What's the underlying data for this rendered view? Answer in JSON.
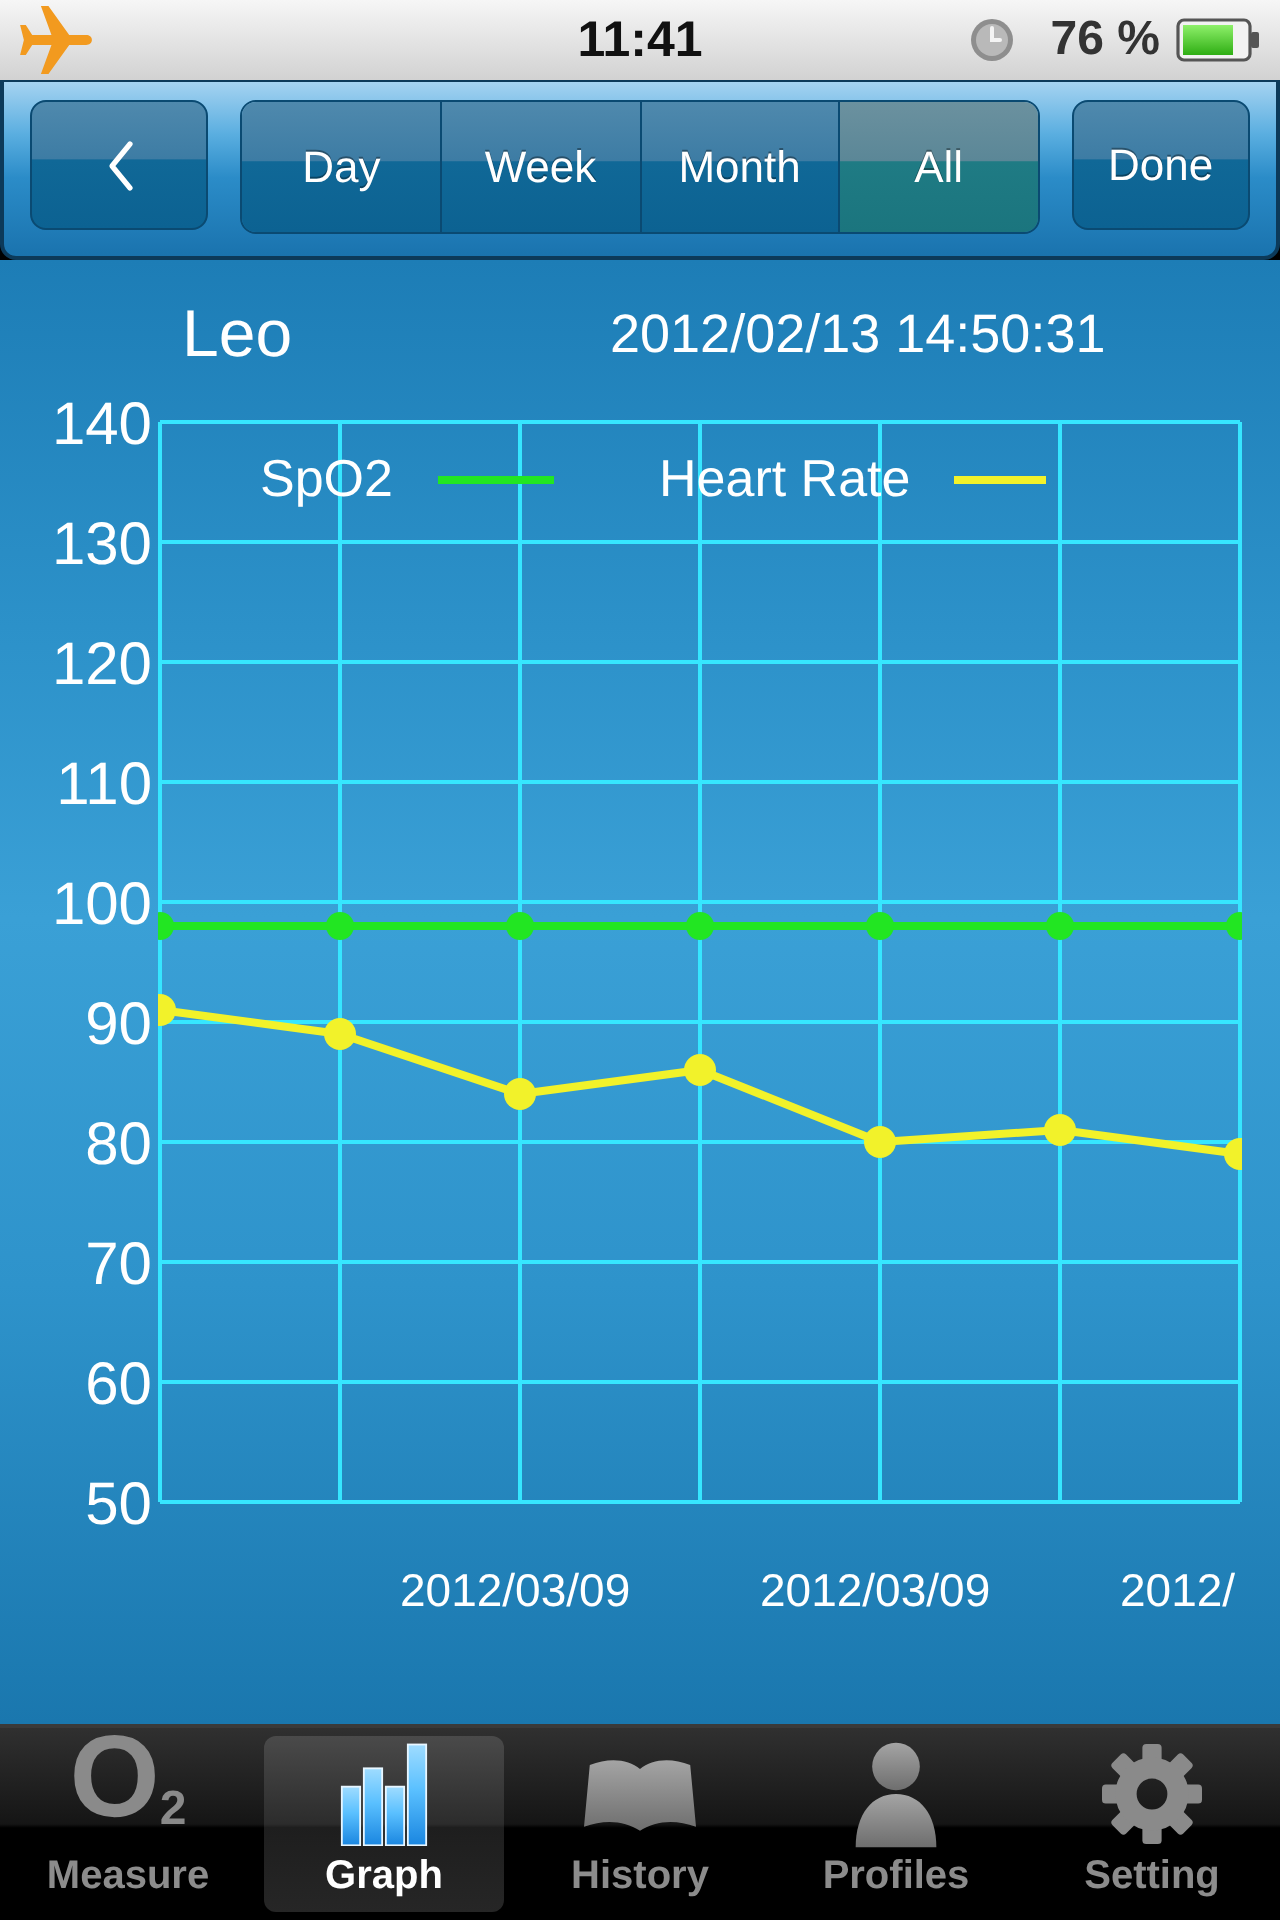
{
  "status_bar": {
    "time": "11:41",
    "battery_percent": "76 %"
  },
  "nav_bar": {
    "segments": [
      {
        "label": "Day",
        "selected": false
      },
      {
        "label": "Week",
        "selected": false
      },
      {
        "label": "Month",
        "selected": false
      },
      {
        "label": "All",
        "selected": true
      }
    ],
    "done_button": "Done"
  },
  "graph": {
    "profile_name": "Leo",
    "timestamp": "2012/02/13 14:50:31",
    "chart_data": {
      "type": "line",
      "categories": [
        null,
        null,
        "2012/03/09",
        null,
        "2012/03/09",
        null,
        "2012/"
      ],
      "ylim": [
        50,
        140
      ],
      "yticks": [
        50,
        60,
        70,
        80,
        90,
        100,
        110,
        120,
        130,
        140
      ],
      "grid": true,
      "legend": "top",
      "series": [
        {
          "name": "SpO2",
          "color": "#22e622",
          "marker": "circle",
          "values": [
            98,
            98,
            98,
            98,
            98,
            98,
            98
          ]
        },
        {
          "name": "Heart Rate",
          "color": "#f2f22a",
          "marker": "circle",
          "values": [
            91,
            89,
            84,
            86,
            80,
            81,
            79
          ]
        }
      ]
    }
  },
  "tab_bar": {
    "tabs": [
      {
        "label": "Measure",
        "kind": "o2",
        "icon_text": "O$_{2}$",
        "selected": false
      },
      {
        "label": "Graph",
        "kind": "bars",
        "selected": true
      },
      {
        "label": "History",
        "kind": "book",
        "selected": false
      },
      {
        "label": "Profiles",
        "kind": "person",
        "selected": false
      },
      {
        "label": "Setting",
        "kind": "gear",
        "selected": false
      }
    ]
  }
}
